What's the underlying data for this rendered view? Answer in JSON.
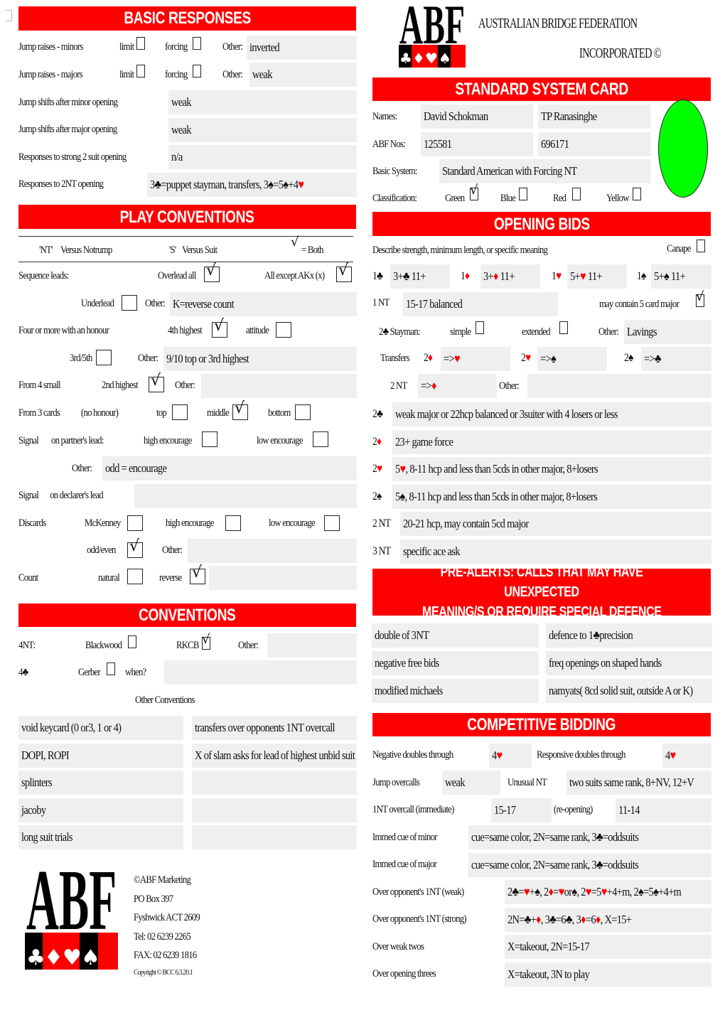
{
  "corner_checkbox": {
    "checked": false
  },
  "basic_responses": {
    "title": "BASIC RESPONSES",
    "jump_raises_minors": {
      "label": "Jump raises - minors",
      "limit_label": "limit",
      "limit": false,
      "forcing_label": "forcing",
      "forcing": false,
      "other_label": "Other:",
      "other": "inverted"
    },
    "jump_raises_majors": {
      "label": "Jump raises - majors",
      "limit_label": "limit",
      "limit": false,
      "forcing_label": "forcing",
      "forcing": false,
      "other_label": "Other:",
      "other": "weak"
    },
    "jump_shifts_minor": {
      "label": "Jump shifts after minor opening",
      "value": "weak"
    },
    "jump_shifts_major": {
      "label": "Jump shifts after major opening",
      "value": "weak"
    },
    "strong_2_suit": {
      "label": "Responses to strong 2 suit opening",
      "value": "n/a"
    },
    "responses_2nt": {
      "label": "Responses to 2NT opening",
      "value": "3♣=puppet stayman, transfers, 3♠=5♠+4♥"
    }
  },
  "header": {
    "org_line1": "AUSTRALIAN BRIDGE FEDERATION",
    "org_line2": "INCORPORATED ©",
    "logo_text": "ABF"
  },
  "system_card": {
    "title": "STANDARD SYSTEM CARD",
    "names_label": "Names:",
    "name1": "David Schokman",
    "name2": "TP Ranasinghe",
    "abf_label": "ABF Nos:",
    "abf1": "125581",
    "abf2": "696171",
    "basic_label": "Basic System:",
    "basic": "Standard American with Forcing NT",
    "classification_label": "Classification:",
    "classes": [
      {
        "label": "Green",
        "checked": true
      },
      {
        "label": "Blue",
        "checked": false
      },
      {
        "label": "Red",
        "checked": false
      },
      {
        "label": "Yellow",
        "checked": false
      }
    ],
    "classification_color": "#00ff00"
  },
  "play_conventions": {
    "title": "PLAY CONVENTIONS",
    "legend_nt": "'NT'",
    "legend_nt_desc": "Versus Notrump",
    "legend_s": "'S'",
    "legend_s_desc": "Versus Suit",
    "legend_both": "= Both",
    "sequence_label": "Sequence leads:",
    "overlead_all_label": "Overlead all",
    "overlead_all": true,
    "all_except_label": "All except AKx (x)",
    "all_except": true,
    "underlead_label": "Underlead",
    "underlead": false,
    "seq_other_label": "Other:",
    "seq_other": "K=reverse count",
    "four_more_label": "Four or more with an honour",
    "fourth_highest_label": "4th highest",
    "fourth_highest": true,
    "attitude_label": "attitude",
    "attitude": false,
    "third_fifth_label": "3rd/5th",
    "third_fifth": false,
    "four_other_label": "Other:",
    "four_other": "9/10 top or 3rd highest",
    "from4_label": "From 4 small",
    "second_highest_label": "2nd highest",
    "second_highest": true,
    "from4_other_label": "Other:",
    "from4_other": "",
    "from3_label": "From 3 cards",
    "no_honour_label": "(no honour)",
    "top_label": "top",
    "top": false,
    "middle_label": "middle",
    "middle": true,
    "bottom_label": "bottom",
    "bottom": false,
    "signal_label": "Signal",
    "partner_lead_label": "on partner's lead:",
    "high_enc_label": "high encourage",
    "high_enc": false,
    "low_enc_label": "low encourage",
    "low_enc": false,
    "signal_other_label": "Other:",
    "signal_other": "odd = encourage",
    "signal2_label": "Signal",
    "declarer_lead_label": "on declarer's lead",
    "declarer_lead": "",
    "discards_label": "Discards",
    "mckenney_label": "McKenney",
    "mckenney": false,
    "disc_high_label": "high encourage",
    "disc_high": false,
    "disc_low_label": "low encourage",
    "disc_low": false,
    "odd_even_label": "odd/even",
    "odd_even": true,
    "disc_other_label": "Other:",
    "disc_other": "",
    "count_label": "Count",
    "natural_label": "natural",
    "natural": false,
    "reverse_label": "reverse",
    "reverse": true,
    "count_other": ""
  },
  "conventions": {
    "title": "CONVENTIONS",
    "fournt_label": "4NT:",
    "blackwood_label": "Blackwood",
    "blackwood": false,
    "rkcb_label": "RKCB",
    "rkcb": true,
    "fournt_other_label": "Other:",
    "fournt_other": "",
    "fourc_label": "4♣",
    "gerber_label": "Gerber",
    "gerber": false,
    "when_label": "when?",
    "when": "",
    "other_label": "Other Conventions",
    "left": [
      "void keycard (0 or3, 1 or 4)",
      "DOPI, ROPI",
      "splinters",
      "jacoby",
      "long suit trials"
    ],
    "right": [
      "transfers over opponents 1NT overcall",
      "X of slam asks for lead of highest unbid suit",
      "",
      "",
      ""
    ]
  },
  "footer": {
    "lines": [
      "©ABF Marketing",
      "PO Box 397",
      "Fyshwick ACT 2609",
      "Tel: 02 6239 2265",
      "FAX: 02 6239 1816"
    ],
    "copyright": "Copyright © BCC 6.3.20.1"
  },
  "opening_bids": {
    "title": "OPENING BIDS",
    "describe_label": "Describe strength, minimum length, or specific meaning",
    "canape_label": "Canape",
    "canape": false,
    "one_level": [
      {
        "bid": "1♣",
        "value": "3+♣ 11+"
      },
      {
        "bid": "1♦",
        "value": "3+♦ 11+"
      },
      {
        "bid": "1♥",
        "value": "5+♥ 11+"
      },
      {
        "bid": "1♠",
        "value": "5+♠ 11+"
      }
    ],
    "one_nt_label": "1 NT",
    "one_nt": "15-17 balanced",
    "five_card_major_label": "may contain 5 card major",
    "five_card_major": true,
    "stayman_label": "2♣ Stayman:",
    "simple_label": "simple",
    "simple": false,
    "extended_label": "extended",
    "extended": false,
    "stayman_other_label": "Other:",
    "stayman_other": "Lavings",
    "transfers_label": "Transfers",
    "transfers": [
      {
        "bid": "2♦",
        "value": "=>♥"
      },
      {
        "bid": "2♥",
        "value": "=>♠"
      },
      {
        "bid": "2♠",
        "value": "=>♣"
      }
    ],
    "two_nt_transfer_label": "2 NT",
    "two_nt_transfer": "=>♦",
    "transfer_other_label": "Other:",
    "transfer_other": "",
    "two_level": [
      {
        "bid": "2♣",
        "value": "weak major or 22hcp balanced or 3suiter with 4 losers or less"
      },
      {
        "bid": "2♦",
        "value": "23+ game force"
      },
      {
        "bid": "2♥",
        "value": "5♥, 8-11 hcp and less than 5cds in other major, 8+losers"
      },
      {
        "bid": "2♠",
        "value": "5♠,  8-11 hcp and less than 5cds in other major, 8+losers"
      },
      {
        "bid": "2 NT",
        "value": "20-21 hcp, may contain 5cd major"
      },
      {
        "bid": "3 NT",
        "value": "specific ace ask"
      }
    ]
  },
  "pre_alerts": {
    "title_line1": "PRE-ALERTS: CALLS THAT MAY HAVE UNEXPECTED",
    "title_line2": "MEANING/S OR REQUIRE SPECIAL DEFENCE",
    "left": [
      "double of 3NT",
      "negative free bids",
      "modified michaels"
    ],
    "right": [
      "defence to 1♣precision",
      "freq openings on shaped hands",
      "namyats( 8cd solid suit, outside A or K)"
    ]
  },
  "competitive": {
    "title": "COMPETITIVE BIDDING",
    "neg_dbl_label": "Negative doubles through",
    "neg_dbl": "4♥",
    "resp_dbl_label": "Responsive doubles through",
    "resp_dbl": "4♥",
    "jump_oc_label": "Jump overcalls",
    "jump_oc": "weak",
    "unusual_label": "Unusual NT",
    "unusual": "two suits same rank, 8+NV, 12+V",
    "nt_oc_label": "1NT overcall (immediate)",
    "nt_oc": "15-17",
    "reopen_label": "(re-opening)",
    "reopen": "11-14",
    "cue_minor_label": "Immed cue of minor",
    "cue_minor": "cue=same color, 2N=same rank, 3♣=oddsuits",
    "cue_major_label": "Immed cue of major",
    "cue_major": "cue=same color, 2N=same rank, 3♣=oddsuits",
    "weak_nt_label": "Over opponent's 1NT (weak)",
    "weak_nt": "2♣=♥+♠, 2♦=♥or♠, 2♥=5♥+4+m, 2♠=5♠+4+m",
    "strong_nt_label": "Over opponent's 1NT (strong)",
    "strong_nt": "2N=♣+♦, 3♣=6♣, 3♦=6♦, X=15+",
    "weak_twos_label": "Over weak twos",
    "weak_twos": "X=takeout, 2N=15-17",
    "threes_label": "Over opening threes",
    "threes": "X=takeout, 3N to play"
  }
}
